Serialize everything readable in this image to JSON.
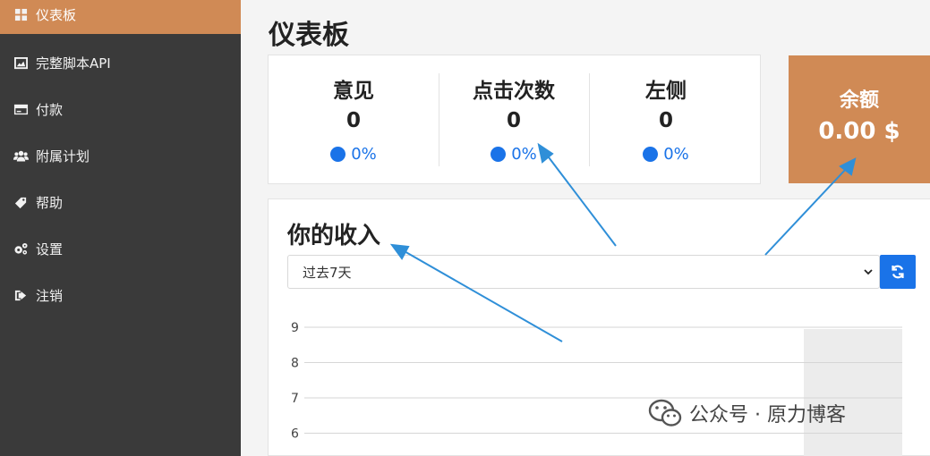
{
  "sidebar": {
    "items": [
      {
        "label": "仪表板",
        "icon": "grid-icon",
        "active": true
      },
      {
        "label": "完整脚本API",
        "icon": "image-icon",
        "active": false
      },
      {
        "label": "付款",
        "icon": "credit-card-icon",
        "active": false
      },
      {
        "label": "附属计划",
        "icon": "users-icon",
        "active": false
      },
      {
        "label": "帮助",
        "icon": "tag-icon",
        "active": false
      },
      {
        "label": "设置",
        "icon": "gears-icon",
        "active": false
      },
      {
        "label": "注销",
        "icon": "sign-out-icon",
        "active": false
      }
    ]
  },
  "main": {
    "title": "仪表板",
    "stats": [
      {
        "label": "意见",
        "value": "0",
        "change": "0%"
      },
      {
        "label": "点击次数",
        "value": "0",
        "change": "0%"
      },
      {
        "label": "左侧",
        "value": "0",
        "change": "0%"
      }
    ],
    "balance": {
      "label": "余额",
      "value": "0.00 $"
    },
    "income": {
      "title": "你的收入",
      "period_selected": "过去7天"
    }
  },
  "chart_data": {
    "type": "line",
    "y_ticks": [
      9,
      8,
      7,
      6
    ],
    "grid": true
  },
  "watermark": {
    "text": "公众号 · 原力博客",
    "icon": "wechat-icon"
  },
  "colors": {
    "accent": "#d08a55",
    "sidebar_bg": "#3a3a3a",
    "primary_blue": "#1a73e8",
    "annotation_arrow": "#2f8fd8"
  }
}
